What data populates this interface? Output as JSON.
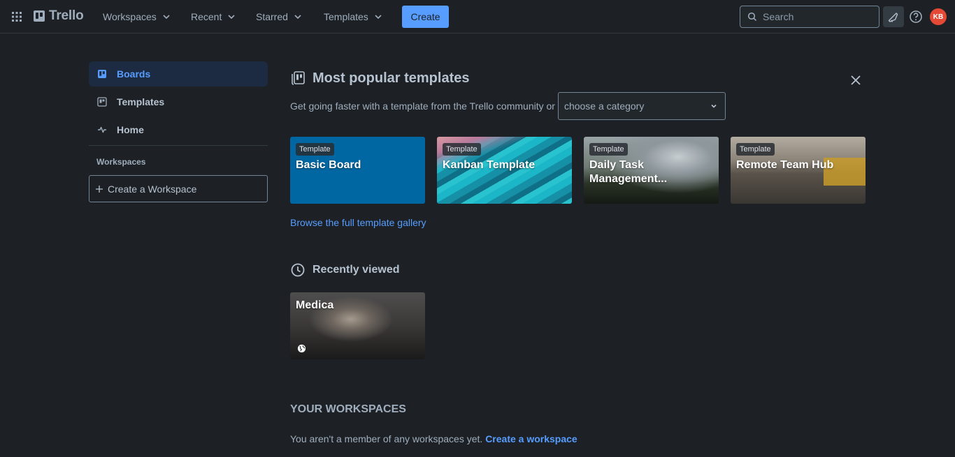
{
  "topbar": {
    "logo": "Trello",
    "nav": [
      {
        "label": "Workspaces"
      },
      {
        "label": "Recent"
      },
      {
        "label": "Starred"
      },
      {
        "label": "Templates"
      }
    ],
    "create_label": "Create",
    "search_placeholder": "Search",
    "avatar_initials": "KB"
  },
  "sidebar": {
    "items": [
      {
        "label": "Boards",
        "icon": "board-icon",
        "active": true
      },
      {
        "label": "Templates",
        "icon": "templates-icon",
        "active": false
      },
      {
        "label": "Home",
        "icon": "home-activity-icon",
        "active": false
      }
    ],
    "workspaces_heading": "Workspaces",
    "create_workspace_label": "Create a Workspace"
  },
  "templates": {
    "title": "Most popular templates",
    "subtitle": "Get going faster with a template from the Trello community or",
    "category_placeholder": "choose a category",
    "badge": "Template",
    "tiles": [
      {
        "title": "Basic Board"
      },
      {
        "title": "Kanban Template"
      },
      {
        "title": "Daily Task Management..."
      },
      {
        "title": "Remote Team Hub"
      }
    ],
    "browse_link": "Browse the full template gallery"
  },
  "recent": {
    "title": "Recently viewed",
    "boards": [
      {
        "title": "Medica",
        "visibility_icon": "globe-icon"
      }
    ]
  },
  "workspaces": {
    "heading": "YOUR WORKSPACES",
    "empty_text": "You aren't a member of any workspaces yet.",
    "create_link": "Create a workspace"
  },
  "colors": {
    "background": "#1d2125",
    "accent": "#579dff",
    "avatar": "#e34935",
    "basic_board_tile": "#0067a3"
  }
}
